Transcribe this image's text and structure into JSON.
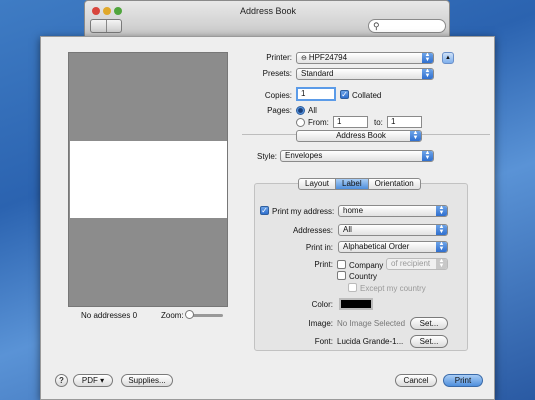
{
  "address_book_window": {
    "title": "Address Book"
  },
  "preview": {
    "status": "No addresses  0",
    "zoom_label": "Zoom:"
  },
  "printer": {
    "label": "Printer:",
    "value": "HPF24794"
  },
  "presets": {
    "label": "Presets:",
    "value": "Standard"
  },
  "copies": {
    "label": "Copies:",
    "value": "1",
    "collated_label": "Collated",
    "collated": true
  },
  "pages": {
    "label": "Pages:",
    "all_label": "All",
    "from_label": "From:",
    "from_value": "1",
    "to_label": "to:",
    "to_value": "1"
  },
  "section_popup": {
    "value": "Address Book"
  },
  "style": {
    "label": "Style:",
    "value": "Envelopes"
  },
  "tabs": {
    "layout": "Layout",
    "label": "Label",
    "orientation": "Orientation",
    "active": "Label"
  },
  "label_tab": {
    "print_my_address_label": "Print my address:",
    "print_my_address_value": "home",
    "addresses_label": "Addresses:",
    "addresses_value": "All",
    "print_in_label": "Print in:",
    "print_in_value": "Alphabetical Order",
    "print_label": "Print:",
    "company_label": "Company",
    "company_popup": "of recipient",
    "country_label": "Country",
    "except_country_label": "Except my country",
    "color_label": "Color:",
    "color_value": "#000000",
    "image_label": "Image:",
    "image_value": "No Image Selected",
    "image_set_button": "Set...",
    "font_label": "Font:",
    "font_value": "Lucida Grande-1...",
    "font_set_button": "Set..."
  },
  "footer": {
    "help": "?",
    "pdf_button": "PDF ▾",
    "supplies_button": "Supplies...",
    "cancel_button": "Cancel",
    "print_button": "Print"
  }
}
